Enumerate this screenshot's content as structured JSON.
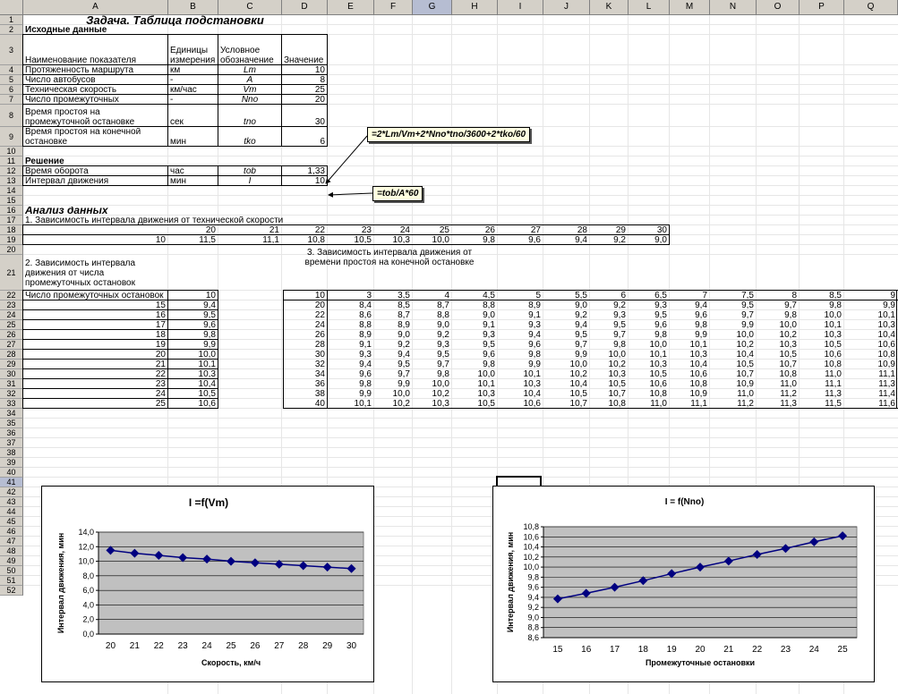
{
  "columns": [
    "A",
    "B",
    "C",
    "D",
    "E",
    "F",
    "G",
    "H",
    "I",
    "J",
    "K",
    "L",
    "M",
    "N",
    "O",
    "P",
    "Q"
  ],
  "rows": [
    "1",
    "2",
    "3",
    "4",
    "5",
    "6",
    "7",
    "8",
    "9",
    "10",
    "11",
    "12",
    "13",
    "14",
    "15",
    "16",
    "17",
    "18",
    "19",
    "20",
    "21",
    "22",
    "23",
    "24",
    "25",
    "26",
    "27",
    "28",
    "29",
    "30",
    "31",
    "32",
    "33",
    "34",
    "35",
    "36",
    "37",
    "38",
    "39",
    "40",
    "41",
    "42",
    "43",
    "44",
    "45",
    "46",
    "47",
    "48",
    "49",
    "50",
    "51",
    "52"
  ],
  "title": "Задача. Таблица подстановки",
  "source": {
    "heading": "Исходные данные",
    "headers": {
      "name": "Наименование показателя",
      "unit": "Единицы измерения",
      "symbol": "Условное обозначение",
      "value": "Значение"
    },
    "items": [
      {
        "name": "Протяженность маршрута",
        "unit": "км",
        "symbol": "Lm",
        "value": "10"
      },
      {
        "name": "Число автобусов",
        "unit": "-",
        "symbol": "A",
        "value": "8"
      },
      {
        "name": "Техническая скорость",
        "unit": "км/час",
        "symbol": "Vm",
        "value": "25"
      },
      {
        "name": "Число промежуточных",
        "unit": "-",
        "symbol": "Nno",
        "value": "20"
      },
      {
        "name": "Время простоя на промежуточной остановке",
        "unit": "сек",
        "symbol": "tno",
        "value": "30"
      },
      {
        "name": "Время простоя на конечной остановке",
        "unit": "мин",
        "symbol": "tko",
        "value": "6"
      }
    ]
  },
  "solution": {
    "heading": "Решение",
    "items": [
      {
        "name": "Время оборота",
        "unit": "час",
        "symbol": "tob",
        "value": "1,33"
      },
      {
        "name": "Интервал движения",
        "unit": "мин",
        "symbol": "I",
        "value": "10"
      }
    ]
  },
  "notes": {
    "formula1": "=2*Lm/Vm+2*Nno*tno/3600+2*tko/60",
    "formula2": "=tob/A*60"
  },
  "analysis": {
    "heading": "Анализ данных",
    "t1_title": "1. Зависимость интервала движения от технической скорости",
    "t1_header": [
      "20",
      "21",
      "22",
      "23",
      "24",
      "25",
      "26",
      "27",
      "28",
      "29",
      "30"
    ],
    "t1_first": "10",
    "t1_values": [
      "11,5",
      "11,1",
      "10,8",
      "10,5",
      "10,3",
      "10,0",
      "9,8",
      "9,6",
      "9,4",
      "9,2",
      "9,0"
    ],
    "t2_title": "2. Зависимость интервала движения от числа промежуточных остановок",
    "t2_label": "Число промежуточных остановок",
    "t2_top": "10",
    "t2_rows": [
      [
        "15",
        "9,4"
      ],
      [
        "16",
        "9,5"
      ],
      [
        "17",
        "9,6"
      ],
      [
        "18",
        "9,8"
      ],
      [
        "19",
        "9,9"
      ],
      [
        "20",
        "10,0"
      ],
      [
        "21",
        "10,1"
      ],
      [
        "22",
        "10,3"
      ],
      [
        "23",
        "10,4"
      ],
      [
        "24",
        "10,5"
      ],
      [
        "25",
        "10,6"
      ]
    ],
    "t3_title": "3. Зависимость интервала движения от времени простоя на конечной остановке",
    "t3_corner": "10",
    "t3_header": [
      "3",
      "3,5",
      "4",
      "4,5",
      "5",
      "5,5",
      "6",
      "6,5",
      "7",
      "7,5",
      "8",
      "8,5",
      "9"
    ],
    "t3_rowlabels": [
      "20",
      "22",
      "24",
      "26",
      "28",
      "30",
      "32",
      "34",
      "36",
      "38",
      "40"
    ],
    "t3_values": [
      [
        "8,4",
        "8,5",
        "8,7",
        "8,8",
        "8,9",
        "9,0",
        "9,2",
        "9,3",
        "9,4",
        "9,5",
        "9,7",
        "9,8",
        "9,9"
      ],
      [
        "8,6",
        "8,7",
        "8,8",
        "9,0",
        "9,1",
        "9,2",
        "9,3",
        "9,5",
        "9,6",
        "9,7",
        "9,8",
        "10,0",
        "10,1"
      ],
      [
        "8,8",
        "8,9",
        "9,0",
        "9,1",
        "9,3",
        "9,4",
        "9,5",
        "9,6",
        "9,8",
        "9,9",
        "10,0",
        "10,1",
        "10,3"
      ],
      [
        "8,9",
        "9,0",
        "9,2",
        "9,3",
        "9,4",
        "9,5",
        "9,7",
        "9,8",
        "9,9",
        "10,0",
        "10,2",
        "10,3",
        "10,4"
      ],
      [
        "9,1",
        "9,2",
        "9,3",
        "9,5",
        "9,6",
        "9,7",
        "9,8",
        "10,0",
        "10,1",
        "10,2",
        "10,3",
        "10,5",
        "10,6"
      ],
      [
        "9,3",
        "9,4",
        "9,5",
        "9,6",
        "9,8",
        "9,9",
        "10,0",
        "10,1",
        "10,3",
        "10,4",
        "10,5",
        "10,6",
        "10,8"
      ],
      [
        "9,4",
        "9,5",
        "9,7",
        "9,8",
        "9,9",
        "10,0",
        "10,2",
        "10,3",
        "10,4",
        "10,5",
        "10,7",
        "10,8",
        "10,9"
      ],
      [
        "9,6",
        "9,7",
        "9,8",
        "10,0",
        "10,1",
        "10,2",
        "10,3",
        "10,5",
        "10,6",
        "10,7",
        "10,8",
        "11,0",
        "11,1"
      ],
      [
        "9,8",
        "9,9",
        "10,0",
        "10,1",
        "10,3",
        "10,4",
        "10,5",
        "10,6",
        "10,8",
        "10,9",
        "11,0",
        "11,1",
        "11,3"
      ],
      [
        "9,9",
        "10,0",
        "10,2",
        "10,3",
        "10,4",
        "10,5",
        "10,7",
        "10,8",
        "10,9",
        "11,0",
        "11,2",
        "11,3",
        "11,4"
      ],
      [
        "10,1",
        "10,2",
        "10,3",
        "10,5",
        "10,6",
        "10,7",
        "10,8",
        "11,0",
        "11,1",
        "11,2",
        "11,3",
        "11,5",
        "11,6"
      ]
    ]
  },
  "chart_data": [
    {
      "type": "line",
      "title": "I =f(Vm)",
      "xlabel": "Скорость, км/ч",
      "ylabel": "Интервал движения, мин",
      "x": [
        20,
        21,
        22,
        23,
        24,
        25,
        26,
        27,
        28,
        29,
        30
      ],
      "x_labels": [
        "20",
        "21",
        "22",
        "23",
        "24",
        "25",
        "26",
        "27",
        "28",
        "29",
        "30"
      ],
      "y": [
        11.5,
        11.1,
        10.8,
        10.5,
        10.3,
        10.0,
        9.8,
        9.6,
        9.4,
        9.2,
        9.0
      ],
      "ylim": [
        0,
        14
      ],
      "ystep": 2,
      "y_labels": [
        "0,0",
        "2,0",
        "4,0",
        "6,0",
        "8,0",
        "10,0",
        "12,0",
        "14,0"
      ],
      "grid": true,
      "color": "#000080",
      "plot_bg": "#c0c0c0"
    },
    {
      "type": "line",
      "title": "I = f(Nno)",
      "xlabel": "Промежуточные остановки",
      "ylabel": "Интервал движения, мин",
      "x": [
        15,
        16,
        17,
        18,
        19,
        20,
        21,
        22,
        23,
        24,
        25
      ],
      "x_labels": [
        "15",
        "16",
        "17",
        "18",
        "19",
        "20",
        "21",
        "22",
        "23",
        "24",
        "25"
      ],
      "y": [
        9.37,
        9.48,
        9.6,
        9.73,
        9.87,
        10.0,
        10.12,
        10.25,
        10.37,
        10.5,
        10.62
      ],
      "ylim": [
        8.6,
        10.8
      ],
      "ystep": 0.2,
      "y_labels": [
        "8,6",
        "8,8",
        "9,0",
        "9,2",
        "9,4",
        "9,6",
        "9,8",
        "10,0",
        "10,2",
        "10,4",
        "10,6",
        "10,8"
      ],
      "grid": true,
      "color": "#000080",
      "plot_bg": "#c0c0c0"
    }
  ]
}
